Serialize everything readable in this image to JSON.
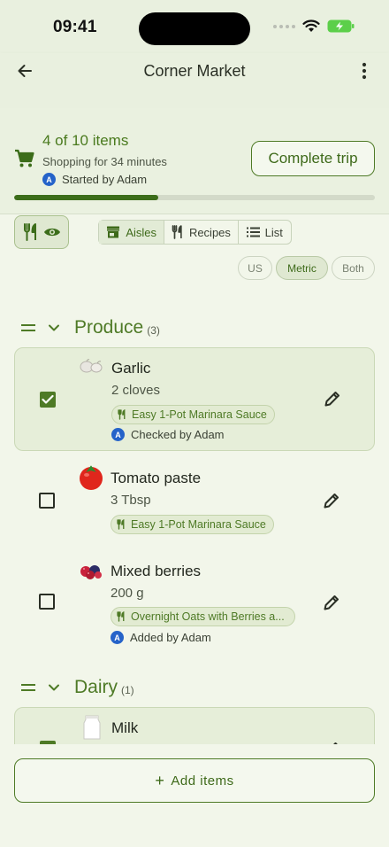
{
  "status_bar": {
    "time": "09:41"
  },
  "header": {
    "title": "Corner Market"
  },
  "progress": {
    "count_text": "4 of 10 items",
    "duration_text": "Shopping for 34 minutes",
    "started_by_text": "Started by Adam",
    "avatar_initial": "A",
    "complete_label": "Complete trip",
    "fraction": 0.4
  },
  "view_modes": [
    {
      "label": "Aisles",
      "icon": "store-icon",
      "active": true
    },
    {
      "label": "Recipes",
      "icon": "fork-knife-icon",
      "active": false
    },
    {
      "label": "List",
      "icon": "list-icon",
      "active": false
    }
  ],
  "units": [
    {
      "label": "US",
      "active": false
    },
    {
      "label": "Metric",
      "active": true
    },
    {
      "label": "Both",
      "active": false
    }
  ],
  "sections": [
    {
      "title": "Produce",
      "count": "(3)",
      "items": [
        {
          "name": "Garlic",
          "qty": "2 cloves",
          "recipe": "Easy 1-Pot Marinara Sauce",
          "by": "Checked by Adam",
          "checked": true,
          "thumb": "garlic-icon"
        },
        {
          "name": "Tomato paste",
          "qty": "3 Tbsp",
          "recipe": "Easy 1-Pot Marinara Sauce",
          "by": "",
          "checked": false,
          "thumb": "tomato-icon"
        },
        {
          "name": "Mixed berries",
          "qty": "200 g",
          "recipe": "Overnight Oats with Berries a...",
          "by": "Added by Adam",
          "checked": false,
          "thumb": "berries-icon"
        }
      ]
    },
    {
      "title": "Dairy",
      "count": "(1)",
      "items": [
        {
          "name": "Milk",
          "qty": "",
          "recipe": "",
          "by": "",
          "checked": true,
          "thumb": "milk-icon"
        }
      ]
    }
  ],
  "footer": {
    "add_label": "Add items",
    "add_prefix": "+"
  },
  "colors": {
    "accent": "#4e7a26",
    "background": "#f2f6ea",
    "avatar": "#2563c9"
  }
}
